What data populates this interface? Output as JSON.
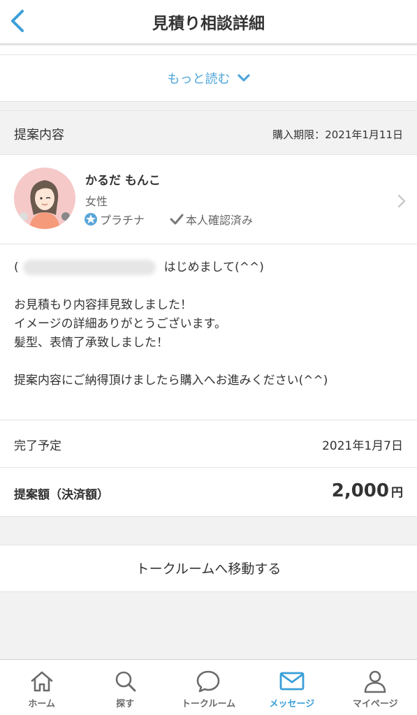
{
  "header": {
    "title": "見積り相談詳細",
    "back_icon": "chevron-left-icon"
  },
  "read_more": {
    "label": "もっと読む",
    "icon": "chevron-down-icon"
  },
  "proposal": {
    "section_label": "提案内容",
    "deadline_label": "購入期限：",
    "deadline": "2021年1月11日"
  },
  "seller": {
    "name": "かるだ もんこ",
    "gender": "女性",
    "rank": "プラチナ",
    "verification": "本人確認済み"
  },
  "message": {
    "lines": [
      "はじめまして(^^)",
      "",
      "お見積もり内容拝見致しました！",
      "イメージの詳細ありがとうございます。",
      "髪型、表情了承致しました！",
      "",
      "提案内容にご納得頂けましたら購入へお進みください(^^)"
    ]
  },
  "completion": {
    "label": "完了予定",
    "value": "2021年1月7日"
  },
  "price": {
    "label": "提案額（決済額）",
    "amount": "2,000",
    "unit": "円"
  },
  "actions": {
    "talkroom_button": "トークルームへ移動する"
  },
  "tabbar": {
    "items": [
      {
        "label": "ホーム",
        "icon": "home-icon"
      },
      {
        "label": "探す",
        "icon": "search-icon"
      },
      {
        "label": "トークルーム",
        "icon": "chat-bubble-icon"
      },
      {
        "label": "メッセージ",
        "icon": "mail-icon",
        "active": true
      },
      {
        "label": "マイページ",
        "icon": "person-icon"
      }
    ]
  },
  "colors": {
    "accent": "#3a9fd8",
    "background": "#f2f2f2",
    "text": "#333333"
  }
}
